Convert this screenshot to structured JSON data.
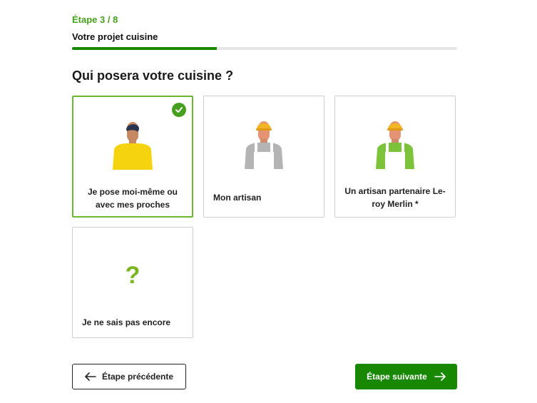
{
  "step": {
    "count": "Étape 3 / 8",
    "title": "Votre projet cuisine",
    "progress_percent": 37.5
  },
  "question": "Qui posera votre cuisine ?",
  "options": [
    {
      "label": "Je pose moi-même ou avec mes proches",
      "selected": true,
      "icon": "person-yellow-shirt-icon"
    },
    {
      "label": "Mon artisan",
      "selected": false,
      "icon": "worker-gray-helmet-icon"
    },
    {
      "label": "Un artisan partenaire Le-roy Merlin *",
      "selected": false,
      "icon": "worker-green-helmet-icon"
    },
    {
      "label": "Je ne sais pas encore",
      "selected": false,
      "icon": "question-mark-icon"
    }
  ],
  "nav": {
    "prev_label": "Étape précédente",
    "next_label": "Étape suivante"
  },
  "colors": {
    "accent": "#46a01e",
    "primary_button": "#188803",
    "selected_border": "#6ab82d"
  }
}
